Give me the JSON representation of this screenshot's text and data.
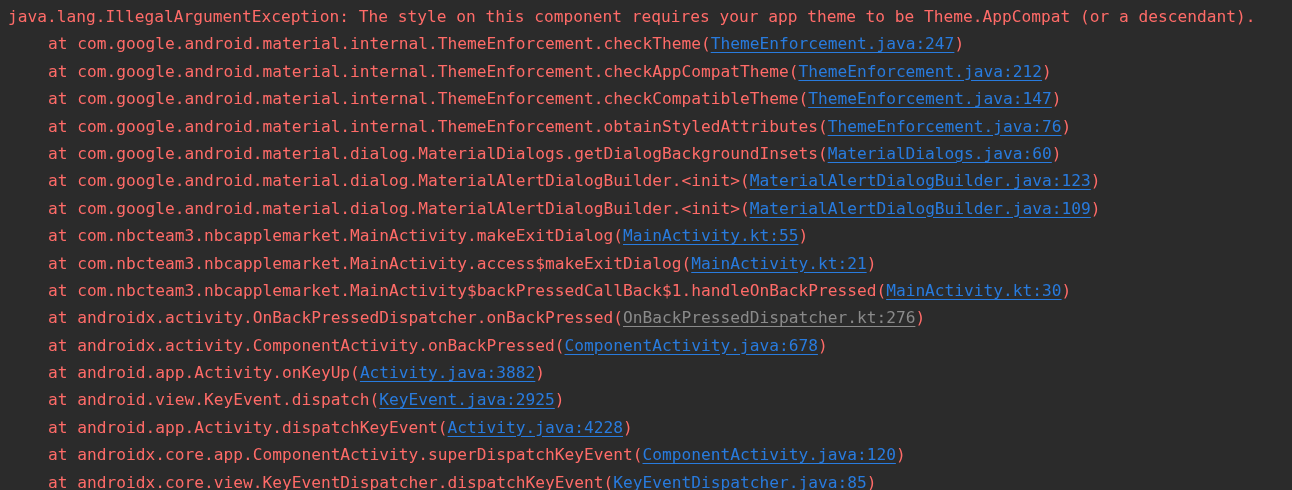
{
  "exception": "java.lang.IllegalArgumentException: The style on this component requires your app theme to be Theme.AppCompat (or a descendant).",
  "frames": [
    {
      "call": "at com.google.android.material.internal.ThemeEnforcement.checkTheme(",
      "link": "ThemeEnforcement.java:247",
      "kind": "source",
      "close": ")"
    },
    {
      "call": "at com.google.android.material.internal.ThemeEnforcement.checkAppCompatTheme(",
      "link": "ThemeEnforcement.java:212",
      "kind": "source",
      "close": ")"
    },
    {
      "call": "at com.google.android.material.internal.ThemeEnforcement.checkCompatibleTheme(",
      "link": "ThemeEnforcement.java:147",
      "kind": "source",
      "close": ")"
    },
    {
      "call": "at com.google.android.material.internal.ThemeEnforcement.obtainStyledAttributes(",
      "link": "ThemeEnforcement.java:76",
      "kind": "source",
      "close": ")"
    },
    {
      "call": "at com.google.android.material.dialog.MaterialDialogs.getDialogBackgroundInsets(",
      "link": "MaterialDialogs.java:60",
      "kind": "source",
      "close": ")"
    },
    {
      "call": "at com.google.android.material.dialog.MaterialAlertDialogBuilder.<init>(",
      "link": "MaterialAlertDialogBuilder.java:123",
      "kind": "source",
      "close": ")"
    },
    {
      "call": "at com.google.android.material.dialog.MaterialAlertDialogBuilder.<init>(",
      "link": "MaterialAlertDialogBuilder.java:109",
      "kind": "source",
      "close": ")"
    },
    {
      "call": "at com.nbcteam3.nbcapplemarket.MainActivity.makeExitDialog(",
      "link": "MainActivity.kt:55",
      "kind": "source",
      "close": ")"
    },
    {
      "call": "at com.nbcteam3.nbcapplemarket.MainActivity.access$makeExitDialog(",
      "link": "MainActivity.kt:21",
      "kind": "source",
      "close": ")"
    },
    {
      "call": "at com.nbcteam3.nbcapplemarket.MainActivity$backPressedCallBack$1.handleOnBackPressed(",
      "link": "MainActivity.kt:30",
      "kind": "source",
      "close": ")"
    },
    {
      "call": "at androidx.activity.OnBackPressedDispatcher.onBackPressed(",
      "link": "OnBackPressedDispatcher.kt:276",
      "kind": "library",
      "close": ")"
    },
    {
      "call": "at androidx.activity.ComponentActivity.onBackPressed(",
      "link": "ComponentActivity.java:678",
      "kind": "source",
      "close": ")"
    },
    {
      "call": "at android.app.Activity.onKeyUp(",
      "link": "Activity.java:3882",
      "kind": "source",
      "close": ")"
    },
    {
      "call": "at android.view.KeyEvent.dispatch(",
      "link": "KeyEvent.java:2925",
      "kind": "source",
      "close": ")"
    },
    {
      "call": "at android.app.Activity.dispatchKeyEvent(",
      "link": "Activity.java:4228",
      "kind": "source",
      "close": ")"
    },
    {
      "call": "at androidx.core.app.ComponentActivity.superDispatchKeyEvent(",
      "link": "ComponentActivity.java:120",
      "kind": "source",
      "close": ")"
    },
    {
      "call": "at androidx.core.view.KeyEventDispatcher.dispatchKeyEvent(",
      "link": "KeyEventDispatcher.java:85",
      "kind": "source",
      "close": ")"
    }
  ]
}
